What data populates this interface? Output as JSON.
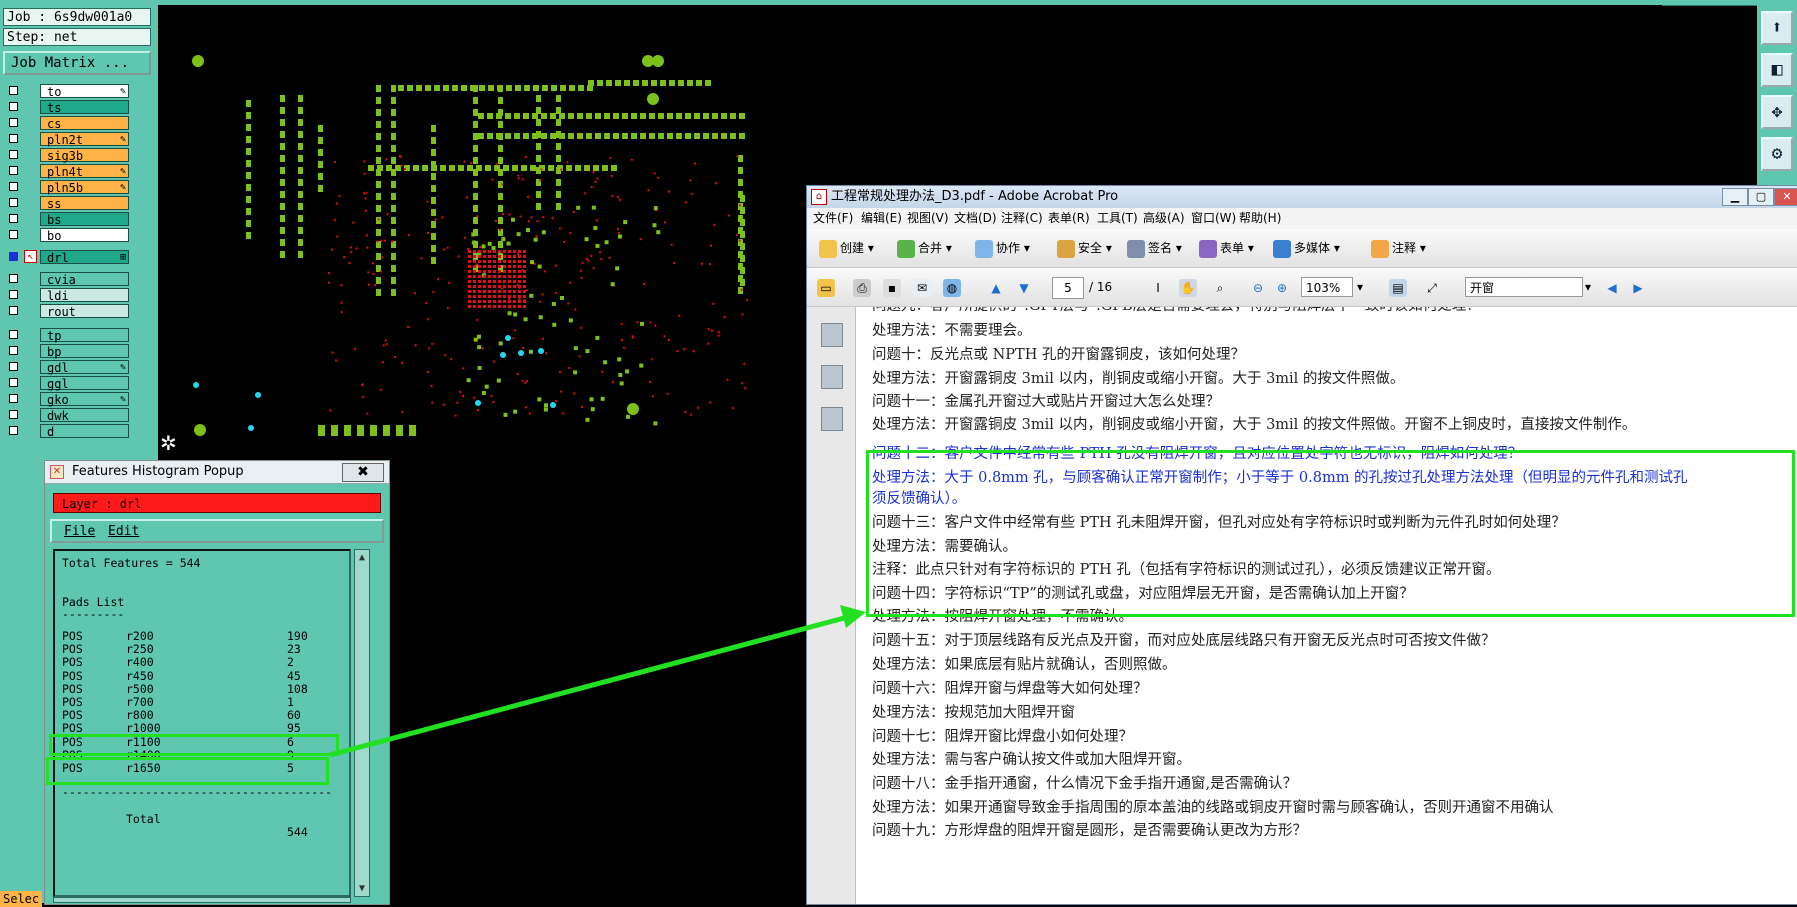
{
  "left_panel": {
    "job": "Job : 6s9dw001a0",
    "step": "Step: net",
    "job_matrix": "Job Matrix ...",
    "layers": [
      {
        "name": "to",
        "bg": "#ffffff",
        "flag": "✎"
      },
      {
        "name": "ts",
        "bg": "#1fa88a",
        "flag": ""
      },
      {
        "name": "cs",
        "bg": "#ffb347",
        "flag": ""
      },
      {
        "name": "pln2t",
        "bg": "#ffb347",
        "flag": "✎"
      },
      {
        "name": "sig3b",
        "bg": "#ffb347",
        "flag": ""
      },
      {
        "name": "pln4t",
        "bg": "#ffb347",
        "flag": "✎"
      },
      {
        "name": "pln5b",
        "bg": "#ffb347",
        "flag": "✎"
      },
      {
        "name": "ss",
        "bg": "#ffb347",
        "flag": ""
      },
      {
        "name": "bs",
        "bg": "#1fa88a",
        "flag": ""
      },
      {
        "name": "bo",
        "bg": "#ffffff",
        "flag": ""
      }
    ],
    "drl": {
      "name": "drl",
      "flag": "⊞"
    },
    "cvia": {
      "name": "cvia"
    },
    "group2": [
      {
        "name": "ldi"
      },
      {
        "name": "rout"
      }
    ],
    "group3": [
      {
        "name": "tp",
        "flag": ""
      },
      {
        "name": "bp",
        "flag": ""
      },
      {
        "name": "gdl",
        "flag": "✎"
      },
      {
        "name": "ggl",
        "flag": ""
      },
      {
        "name": "gko",
        "flag": "✎"
      },
      {
        "name": "dwk",
        "flag": ""
      },
      {
        "name": "d",
        "flag": ""
      }
    ],
    "status_fragment": "Selec"
  },
  "histogram": {
    "title": "Features Histogram Popup",
    "close_icon": "✖",
    "layer_label": "Layer :  drl",
    "menu_file": "File",
    "menu_edit": "Edit",
    "total_features": "Total Features = 544",
    "pads_header": "Pads List",
    "pads_rule": "---------",
    "rows": [
      {
        "a": "POS",
        "b": "r200",
        "c": "190"
      },
      {
        "a": "POS",
        "b": "r250",
        "c": "23"
      },
      {
        "a": "POS",
        "b": "r400",
        "c": "2"
      },
      {
        "a": "POS",
        "b": "r450",
        "c": "45"
      },
      {
        "a": "POS",
        "b": "r500",
        "c": "108"
      },
      {
        "a": "POS",
        "b": "r700",
        "c": "1"
      },
      {
        "a": "POS",
        "b": "r800",
        "c": "60"
      },
      {
        "a": "POS",
        "b": "r1000",
        "c": "95"
      },
      {
        "a": "POS",
        "b": "r1100",
        "c": "6"
      },
      {
        "a": "POS",
        "b": "r1400",
        "c": "9"
      },
      {
        "a": "POS",
        "b": "r1650",
        "c": "5"
      }
    ],
    "rule": "---------------------------------------",
    "total_label": "Total",
    "total_value": "544"
  },
  "acrobat": {
    "title": "工程常规处理办法_D3.pdf - Adobe Acrobat Pro",
    "menu": [
      "文件(F)",
      "编辑(E)",
      "视图(V)",
      "文档(D)",
      "注释(C)",
      "表单(R)",
      "工具(T)",
      "高级(A)",
      "窗口(W)",
      "帮助(H)"
    ],
    "toolbar1": [
      "创建",
      "合并",
      "协作",
      "安全",
      "签名",
      "表单",
      "多媒体",
      "注释"
    ],
    "page": "5",
    "page_total": "/ 16",
    "zoom": "103%",
    "find": "开窗",
    "doc_lines": [
      {
        "text": "问题九：客户所提供的*.GPT层与*.GPB层是否需要理会，特别与阻焊层不一致时该如何处理？",
        "blue": false
      },
      {
        "text": "处理方法：不需要理会。",
        "blue": false
      },
      {
        "text": "问题十：反光点或 NPTH 孔的开窗露铜皮，该如何处理？",
        "blue": false
      },
      {
        "text": "处理方法：开窗露铜皮 3mil 以内，削铜皮或缩小开窗。大于 3mil 的按文件照做。",
        "blue": false
      },
      {
        "text": "问题十一：金属孔开窗过大或贴片开窗过大怎么处理？",
        "blue": false
      },
      {
        "text": "处理方法：开窗露铜皮 3mil 以内，削铜皮或缩小开窗，大于 3mil 的按文件照做。开窗不上铜皮时，直接按文件制作。",
        "blue": false
      },
      {
        "text": "问题十二：客户文件中经常有些 PTH 孔没有阻焊开窗，且对应位置处字符也无标识，阻焊如何处理？",
        "blue": true
      },
      {
        "text": "处理方法：大于 0.8mm 孔，与顾客确认正常开窗制作；小于等于 0.8mm 的孔按过孔处理方法处理（但明显的元件孔和测试孔",
        "blue": true
      },
      {
        "text": "须反馈确认）。",
        "blue": true
      },
      {
        "text": "问题十三：客户文件中经常有些 PTH 孔未阻焊开窗，但孔对应处有字符标识时或判断为元件孔时如何处理？",
        "blue": false
      },
      {
        "text": "处理方法：需要确认。",
        "blue": false
      },
      {
        "text": "    注释：此点只针对有字符标识的 PTH 孔（包括有字符标识的测试过孔），必须反馈建议正常开窗。",
        "blue": false
      },
      {
        "text": "问题十四：字符标识“TP”的测试孔或盘，对应阻焊层无开窗，是否需确认加上开窗？",
        "blue": false
      },
      {
        "text": "处理方法：按阻焊开窗处理，不需确认。",
        "blue": false
      },
      {
        "text": "问题十五：对于顶层线路有反光点及开窗，而对应处底层线路只有开窗无反光点时可否按文件做？",
        "blue": false
      },
      {
        "text": "处理方法：如果底层有贴片就确认，否则照做。",
        "blue": false
      },
      {
        "text": "问题十六：阻焊开窗与焊盘等大如何处理？",
        "blue": false
      },
      {
        "text": "处理方法：按规范加大阻焊开窗",
        "blue": false
      },
      {
        "text": "问题十七：阻焊开窗比焊盘小如何处理？",
        "blue": false
      },
      {
        "text": "处理方法：需与客户确认按文件或加大阻焊开窗。",
        "blue": false
      },
      {
        "text": "问题十八：金手指开通窗，什么情况下金手指开通窗,是否需确认？",
        "blue": false
      },
      {
        "text": "处理方法：如果开通窗导致金手指周围的原本盖油的线路或铜皮开窗时需与顾客确认，否则开通窗不用确认",
        "blue": false
      },
      {
        "text": "问题十九：方形焊盘的阻焊开窗是圆形，是否需要确认更改为方形？",
        "blue": false
      }
    ]
  },
  "colors": {
    "panel": "#5fc6b0",
    "highlight": "#22e022",
    "pad_green": "#7fbf1a",
    "pad_red": "#e01010",
    "pad_cyan": "#22d8f0"
  }
}
